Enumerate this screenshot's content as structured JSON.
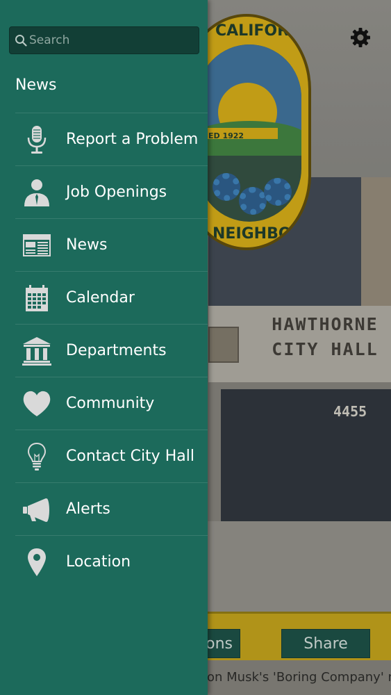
{
  "search": {
    "placeholder": "Search"
  },
  "drawer": {
    "header": "News",
    "items": [
      {
        "label": "Report a Problem",
        "icon": "microphone-icon"
      },
      {
        "label": "Job Openings",
        "icon": "person-icon"
      },
      {
        "label": "News",
        "icon": "newspaper-icon"
      },
      {
        "label": "Calendar",
        "icon": "calendar-icon"
      },
      {
        "label": "Departments",
        "icon": "building-icon"
      },
      {
        "label": "Community",
        "icon": "heart-icon"
      },
      {
        "label": "Contact City Hall",
        "icon": "lightbulb-icon"
      },
      {
        "label": "Alerts",
        "icon": "megaphone-icon"
      },
      {
        "label": "Location",
        "icon": "map-pin-icon"
      }
    ]
  },
  "background": {
    "seal_top_text": "CALIFORNIA",
    "seal_bottom_text": "NEIGHBORS",
    "seal_band_text": "ED 1922",
    "building_line1": "HAWTHORNE",
    "building_line2": "CITY HALL",
    "address": "4455",
    "bottom_buttons": [
      "ons",
      "Share"
    ],
    "ticker": "on Musk's 'Boring Company' ne"
  },
  "colors": {
    "drawer": "#1c6a5b",
    "search_bg": "#123f36",
    "icon": "#d9d9d9",
    "button": "#1c4c43",
    "bar": "#b89a1b"
  }
}
